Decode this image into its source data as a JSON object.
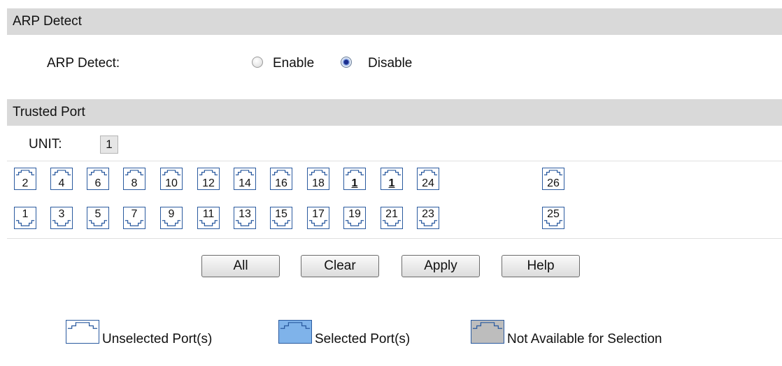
{
  "arp_section": {
    "title": "ARP Detect",
    "field_label": "ARP Detect:",
    "options": [
      "Enable",
      "Disable"
    ],
    "selected": "Disable"
  },
  "trusted_section": {
    "title": "Trusted Port",
    "unit_label": "UNIT:",
    "unit_value": "1"
  },
  "ports": {
    "top_row": [
      "2",
      "4",
      "6",
      "8",
      "10",
      "12",
      "14",
      "16",
      "18",
      "1",
      "1",
      "24",
      "26"
    ],
    "bottom_row": [
      "1",
      "3",
      "5",
      "7",
      "9",
      "11",
      "13",
      "15",
      "17",
      "19",
      "21",
      "23",
      "25"
    ],
    "emphasized_top_indices": [
      9,
      10
    ]
  },
  "buttons": {
    "all": "All",
    "clear": "Clear",
    "apply": "Apply",
    "help": "Help"
  },
  "legend": {
    "unselected": "Unselected Port(s)",
    "selected": "Selected Port(s)",
    "not_available": "Not Available for Selection"
  },
  "colors": {
    "section_bar": "#d9d9d9",
    "port_border": "#2a5a9f",
    "selected_fill": "#7fb3ea",
    "not_available_fill": "#bdbdbd"
  }
}
